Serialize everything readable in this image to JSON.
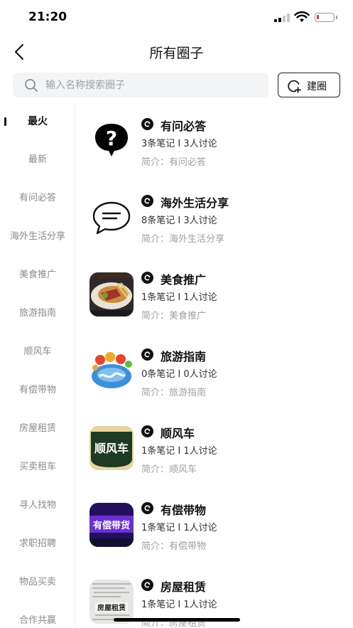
{
  "status_bar": {
    "time": "21:20",
    "battery_level": 0.15
  },
  "nav": {
    "title": "所有圈子"
  },
  "search": {
    "placeholder": "输入名称搜索圈子",
    "value": ""
  },
  "create_button": {
    "label": "建圈"
  },
  "sidebar": {
    "active_index": 0,
    "items": [
      {
        "label": "最火"
      },
      {
        "label": "最新"
      },
      {
        "label": "有问必答"
      },
      {
        "label": "海外生活分享"
      },
      {
        "label": "美食推广"
      },
      {
        "label": "旅游指南"
      },
      {
        "label": "顺风车"
      },
      {
        "label": "有偿带物"
      },
      {
        "label": "房屋租赁"
      },
      {
        "label": "买卖租车"
      },
      {
        "label": "寻人找物"
      },
      {
        "label": "求职招聘"
      },
      {
        "label": "物品买卖"
      },
      {
        "label": "合作共赢"
      }
    ]
  },
  "circles": [
    {
      "name": "有问必答",
      "stats": "3条笔记 I 3人讨论",
      "intro": "简介：有问必答",
      "icon": "question-bubble-icon"
    },
    {
      "name": "海外生活分享",
      "stats": "8条笔记 I 3人讨论",
      "intro": "简介：海外生活分享",
      "icon": "chat-bubble-icon"
    },
    {
      "name": "美食推广",
      "stats": "1条笔记 I 1人讨论",
      "intro": "简介：美食推广",
      "icon": "food-photo"
    },
    {
      "name": "旅游指南",
      "stats": "0条笔记 I 0人讨论",
      "intro": "简介：旅游指南",
      "icon": "travel-globe-image"
    },
    {
      "name": "顺风车",
      "stats": "1条笔记 I 1人讨论",
      "intro": "简介：顺风车",
      "icon": "rideshare-sign-image",
      "image_text": "顺风车"
    },
    {
      "name": "有偿带物",
      "stats": "1条笔记 I 1人讨论",
      "intro": "简介：有偿带物",
      "icon": "paid-delivery-image",
      "image_text": "有偿带货"
    },
    {
      "name": "房屋租赁",
      "stats": "1条笔记 I 1人讨论",
      "intro": "简介：房屋租赁",
      "icon": "rental-notice-image",
      "image_text": "房屋租赁"
    }
  ],
  "colors": {
    "accent": "#111111",
    "muted_text": "#9ea0a5",
    "search_background": "#f3f4f6",
    "battery_low": "#e53935"
  }
}
